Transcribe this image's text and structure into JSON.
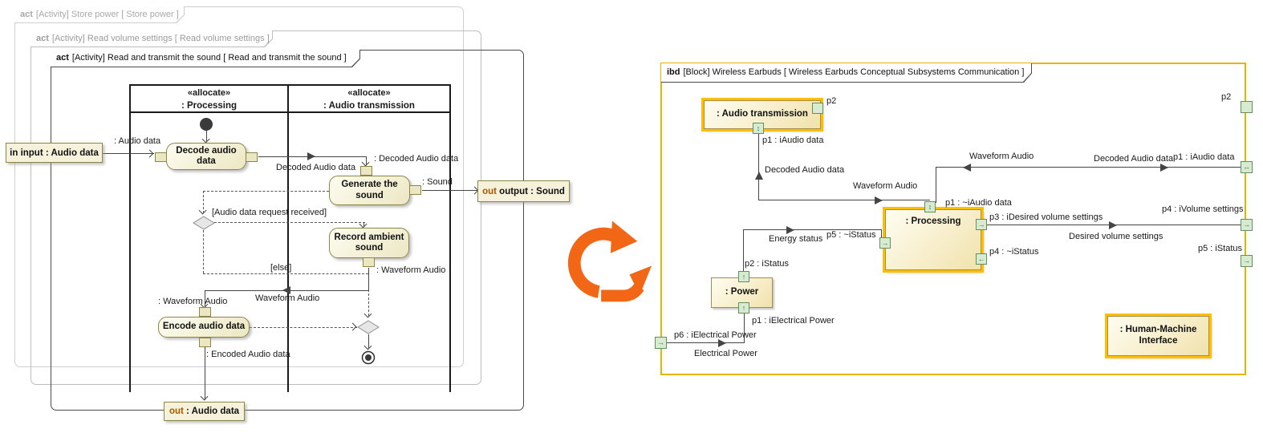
{
  "colors": {
    "highlight": "#FFBF00",
    "ibd_frame": "#E9B400",
    "orange": "#F26716",
    "port_fill": "#D9EAD3",
    "port_border": "#61915C",
    "out_keyword": "#A35A00"
  },
  "left": {
    "frames": [
      {
        "kw": "act",
        "title": "[Activity] Store power [ Store power ]"
      },
      {
        "kw": "act",
        "title": "[Activity] Read volume settings [ Read volume settings ]"
      },
      {
        "kw": "act",
        "title": "[Activity] Read and transmit the sound [ Read and transmit the sound ]"
      }
    ],
    "lanes": [
      {
        "stereo": "«allocate»",
        "name": ": Processing"
      },
      {
        "stereo": "«allocate»",
        "name": ": Audio transmission"
      }
    ],
    "actions": {
      "decode": "Decode audio data",
      "generate": "Generate the sound",
      "record": "Record ambient sound",
      "encode": "Encode audio data"
    },
    "params": {
      "input": {
        "kw": "in",
        "name": "input : Audio data"
      },
      "out_sound": {
        "kw": "out",
        "name": "output : Sound"
      },
      "out_audio": {
        "kw": "out",
        "name": ": Audio data"
      }
    },
    "labels": {
      "audio_data": ": Audio data",
      "decoded_flow": "Decoded Audio data",
      "decoded_pin": ": Decoded Audio data",
      "sound": ": Sound",
      "guard_request": "[Audio data request received]",
      "guard_else": "[else]",
      "waveform_pin_record": ": Waveform Audio",
      "waveform_flow": "Waveform Audio",
      "waveform_pin_encode": ": Waveform Audio",
      "encoded_pin": ": Encoded Audio data"
    }
  },
  "right": {
    "frame": {
      "kw": "ibd",
      "title": "[Block] Wireless Earbuds [ Wireless Earbuds Conceptual Subsystems Communication ]"
    },
    "blocks": {
      "at": ": Audio transmission",
      "proc": ": Processing",
      "power": ": Power",
      "hmi": ": Human-Machine Interface"
    },
    "ports": {
      "at_p2": "p2",
      "at_p1": "p1 : iAudio data",
      "proc_p1": "p1 : ~iAudio data",
      "proc_p3": "p3 : iDesired volume settings",
      "proc_p4": "p4 : ~iStatus",
      "proc_p5": "p5 : ~iStatus",
      "power_p2": "p2 : iStatus",
      "power_p1": "p1 : iElectrical Power",
      "frame_p2": "p2",
      "frame_p1": "p1 : iAudio data",
      "frame_p4": "p4 : iVolume settings",
      "frame_p5": "p5 : iStatus",
      "frame_p6": "p6 : iElectrical Power"
    },
    "flows": {
      "decoded_up": "Decoded Audio data",
      "waveform_right": "Waveform Audio",
      "waveform_left": "Waveform Audio",
      "decoded_out": "Decoded Audio data",
      "desired": "Desired volume settings",
      "energy": "Energy status",
      "electrical": "Electrical Power"
    },
    "glyphs": {
      "updown": "↕",
      "right": "→",
      "left": "←",
      "up": "↑",
      "both": "↔"
    }
  }
}
